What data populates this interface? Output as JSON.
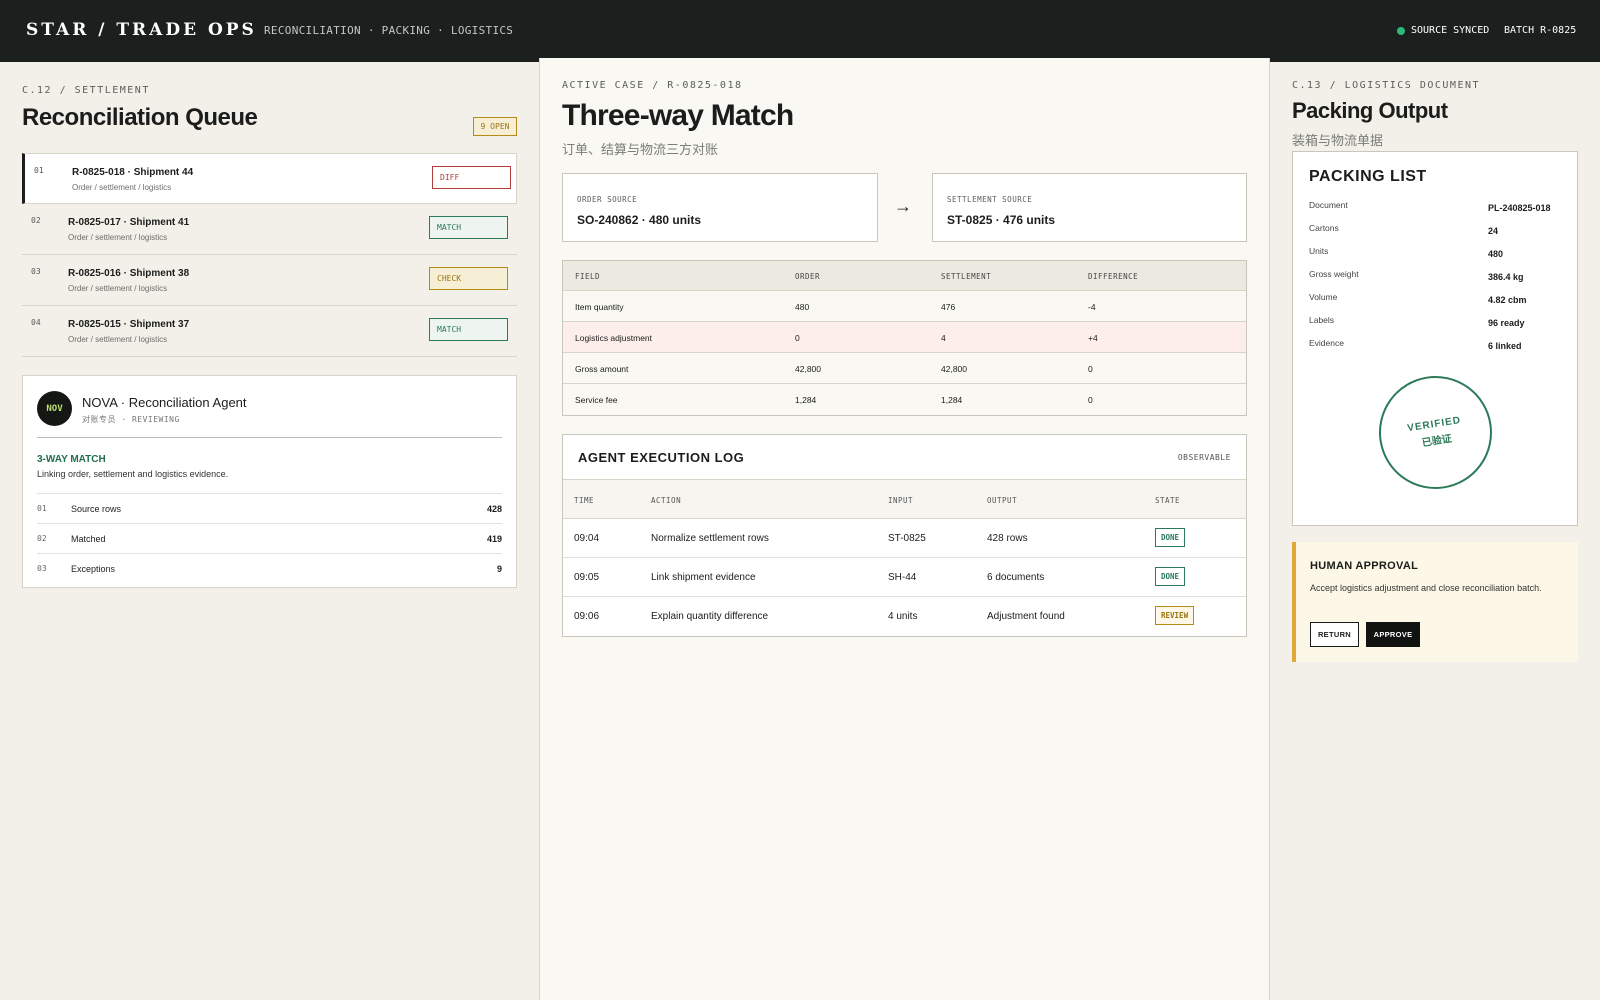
{
  "header": {
    "brand": "STAR / TRADE OPS",
    "nav": "RECONCILIATION · PACKING · LOGISTICS",
    "sync_status": "SOURCE SYNCED",
    "batch": "BATCH R-0825",
    "sync_color": "#2fb87a"
  },
  "left": {
    "eyebrow": "C.12 / SETTLEMENT",
    "title": "Reconciliation Queue",
    "open_badge": "9 OPEN",
    "queue": [
      {
        "num": "01",
        "title": "R-0825-018 · Shipment 44",
        "sub": "Order / settlement / logistics",
        "status": "DIFF"
      },
      {
        "num": "02",
        "title": "R-0825-017 · Shipment 41",
        "sub": "Order / settlement / logistics",
        "status": "MATCH"
      },
      {
        "num": "03",
        "title": "R-0825-016 · Shipment 38",
        "sub": "Order / settlement / logistics",
        "status": "CHECK"
      },
      {
        "num": "04",
        "title": "R-0825-015 · Shipment 37",
        "sub": "Order / settlement / logistics",
        "status": "MATCH"
      }
    ],
    "agent": {
      "avatar": "NOV",
      "name": "NOVA · Reconciliation Agent",
      "sub": "对账专员 · REVIEWING",
      "label": "3-WAY MATCH",
      "desc": "Linking order, settlement and logistics evidence.",
      "stats": [
        {
          "num": "01",
          "label": "Source rows",
          "value": "428"
        },
        {
          "num": "02",
          "label": "Matched",
          "value": "419"
        },
        {
          "num": "03",
          "label": "Exceptions",
          "value": "9"
        }
      ]
    }
  },
  "middle": {
    "eyebrow": "ACTIVE CASE / R-0825-018",
    "title": "Three-way Match",
    "subtitle": "订单、结算与物流三方对账",
    "order_source": {
      "label": "ORDER SOURCE",
      "value": "SO-240862 · 480 units"
    },
    "arrow": "→",
    "settlement_source": {
      "label": "SETTLEMENT SOURCE",
      "value": "ST-0825 · 476 units"
    },
    "compare": {
      "headers": [
        "FIELD",
        "ORDER",
        "SETTLEMENT",
        "DIFFERENCE"
      ],
      "rows": [
        [
          "Item quantity",
          "480",
          "476",
          "-4"
        ],
        [
          "Logistics adjustment",
          "0",
          "4",
          "+4"
        ],
        [
          "Gross amount",
          "42,800",
          "42,800",
          "0"
        ],
        [
          "Service fee",
          "1,284",
          "1,284",
          "0"
        ]
      ]
    },
    "log": {
      "title": "AGENT EXECUTION LOG",
      "tag": "OBSERVABLE",
      "headers": [
        "TIME",
        "ACTION",
        "INPUT",
        "OUTPUT",
        "STATE"
      ],
      "rows": [
        [
          "09:04",
          "Normalize settlement rows",
          "ST-0825",
          "428 rows",
          "DONE"
        ],
        [
          "09:05",
          "Link shipment evidence",
          "SH-44",
          "6 documents",
          "DONE"
        ],
        [
          "09:06",
          "Explain quantity difference",
          "4 units",
          "Adjustment found",
          "REVIEW"
        ]
      ]
    }
  },
  "right": {
    "eyebrow": "C.13 / LOGISTICS DOCUMENT",
    "title": "Packing Output",
    "subtitle": "装箱与物流单据",
    "packing": {
      "title": "PACKING LIST",
      "rows": [
        [
          "Document",
          "PL-240825-018"
        ],
        [
          "Cartons",
          "24"
        ],
        [
          "Units",
          "480"
        ],
        [
          "Gross weight",
          "386.4 kg"
        ],
        [
          "Volume",
          "4.82 cbm"
        ],
        [
          "Labels",
          "96 ready"
        ],
        [
          "Evidence",
          "6 linked"
        ]
      ],
      "stamp_en": "VERIFIED",
      "stamp_cn": "已验证"
    },
    "approval": {
      "title": "HUMAN APPROVAL",
      "desc": "Accept logistics adjustment and close reconciliation batch.",
      "return_label": "RETURN",
      "approve_label": "APPROVE"
    }
  }
}
